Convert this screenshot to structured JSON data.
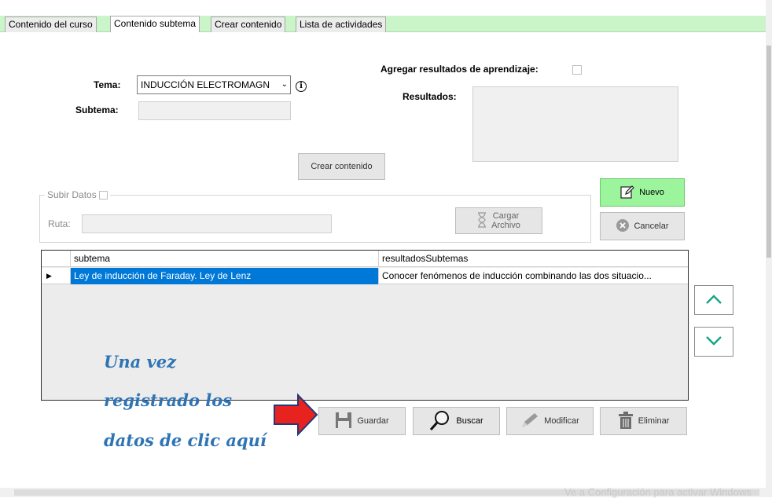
{
  "tabs": [
    {
      "label": "Contenido del curso"
    },
    {
      "label": "Contenido subtema"
    },
    {
      "label": "Crear contenido"
    },
    {
      "label": "Lista de actividades"
    }
  ],
  "form": {
    "tema_label": "Tema:",
    "tema_value": "INDUCCIÓN ELECTROMAGN",
    "subtema_label": "Subtema:",
    "subtema_value": "",
    "agregar_label": "Agregar resultados de aprendizaje:",
    "resultados_label": "Resultados:",
    "crear_button": "Crear contenido"
  },
  "subir": {
    "legend": "Subir Datos",
    "ruta_label": "Ruta:",
    "ruta_value": "",
    "cargar_line1": "Cargar",
    "cargar_line2": "Archivo"
  },
  "actions": {
    "nuevo": "Nuevo",
    "cancelar": "Cancelar",
    "guardar": "Guardar",
    "buscar": "Buscar",
    "modificar": "Modificar",
    "eliminar": "Eliminar"
  },
  "grid": {
    "columns": [
      "subtema",
      "resultadosSubtemas"
    ],
    "rows": [
      {
        "subtema": "Ley de inducción de Faraday. Ley de Lenz",
        "resultados": "Conocer fenómenos de inducción combinando las dos situacio..."
      }
    ]
  },
  "annotation": {
    "line1": "Una vez",
    "line2": "registrado los",
    "line3": "datos de clic aquí"
  },
  "watermark": "Ve a Configuración para activar Windows",
  "colors": {
    "tab_strip": "#c9f5c9",
    "nuevo_bg": "#9cf59c",
    "selection": "#0078d7",
    "annotation": "#2e74b5",
    "pointer_arrow": "#e8231f",
    "nav_arrow": "#15a38b"
  },
  "icons": [
    "info-icon",
    "pencil-note-icon",
    "cancel-x-icon",
    "hourglass-icon",
    "save-floppy-icon",
    "magnifier-icon",
    "pencil-icon",
    "trash-icon",
    "chevron-up-icon",
    "chevron-down-icon",
    "red-arrow-icon",
    "row-pointer-icon"
  ]
}
